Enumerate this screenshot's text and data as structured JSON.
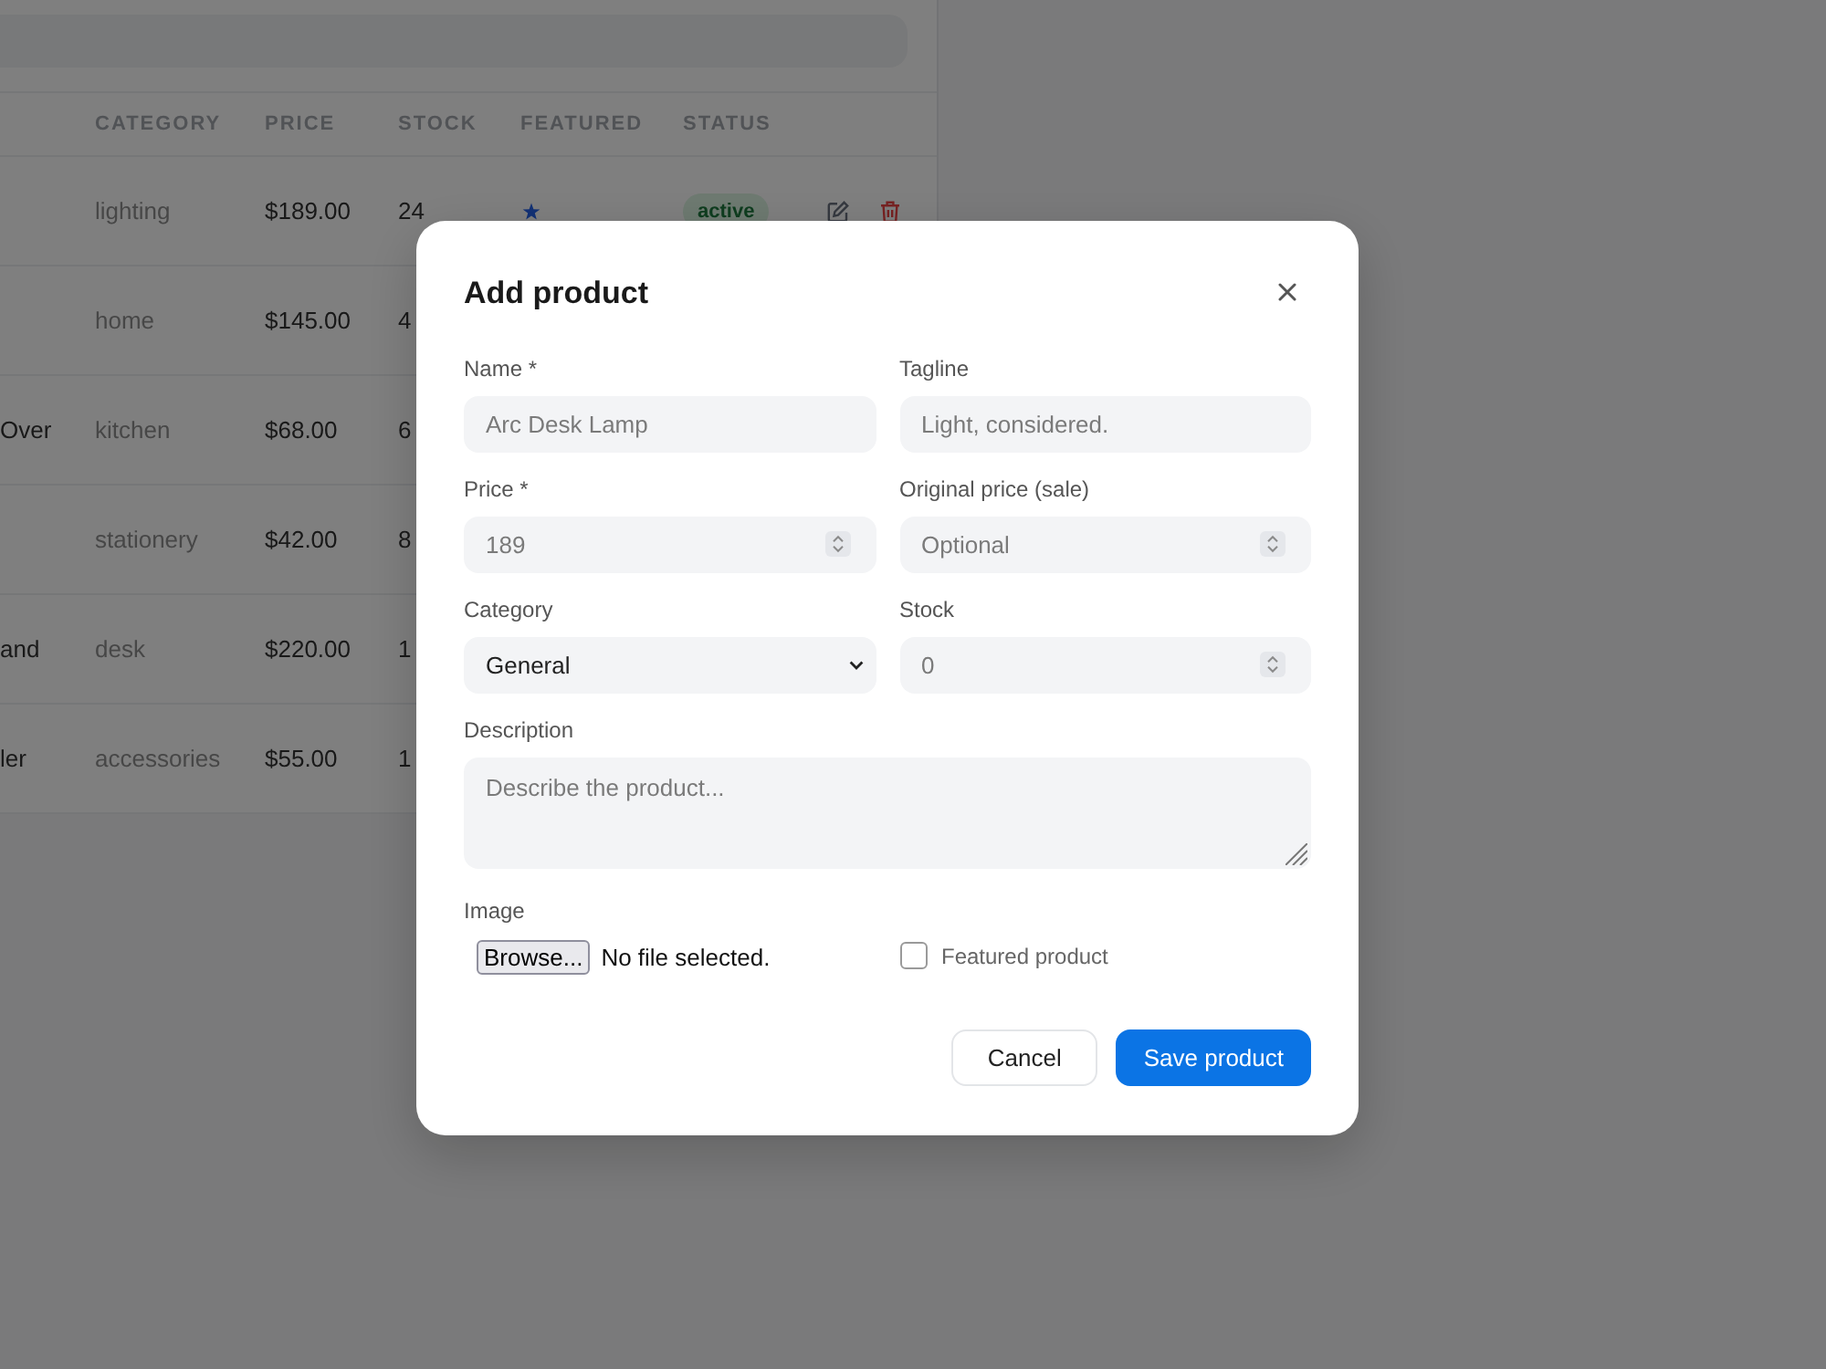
{
  "table": {
    "columns": [
      "CATEGORY",
      "PRICE",
      "STOCK",
      "FEATURED",
      "STATUS"
    ],
    "rows": [
      {
        "category": "lighting",
        "price": "$189.00",
        "stock": "24",
        "featured": true,
        "status": "active"
      },
      {
        "category": "home",
        "price": "$145.00",
        "stock": "4"
      },
      {
        "name": "Over",
        "category": "kitchen",
        "price": "$68.00",
        "stock": "6"
      },
      {
        "category": "stationery",
        "price": "$42.00",
        "stock": "8"
      },
      {
        "name": "and",
        "category": "desk",
        "price": "$220.00",
        "stock": "1"
      },
      {
        "name": "ler",
        "category": "accessories",
        "price": "$55.00",
        "stock": "1"
      }
    ]
  },
  "dialog": {
    "title": "Add product",
    "fields": [
      {
        "kind": "text",
        "label": "Name *",
        "placeholder": "Arc Desk Lamp"
      },
      {
        "kind": "text",
        "label": "Tagline",
        "placeholder": "Light, considered."
      },
      {
        "kind": "number",
        "label": "Price *",
        "placeholder": "189"
      },
      {
        "kind": "number",
        "label": "Original price (sale)",
        "placeholder": "Optional"
      },
      {
        "kind": "select",
        "label": "Category",
        "value": "General"
      },
      {
        "kind": "number",
        "label": "Stock",
        "placeholder": "0"
      },
      {
        "kind": "textarea",
        "label": "Description",
        "placeholder": "Describe the product..."
      }
    ],
    "image": {
      "label": "Image",
      "button": "Browse...",
      "status": "No file selected."
    },
    "featured": {
      "label": "Featured product",
      "checked": false
    },
    "buttons": [
      {
        "kind": "secondary",
        "label": "Cancel"
      },
      {
        "kind": "primary",
        "label": "Save product"
      }
    ]
  }
}
